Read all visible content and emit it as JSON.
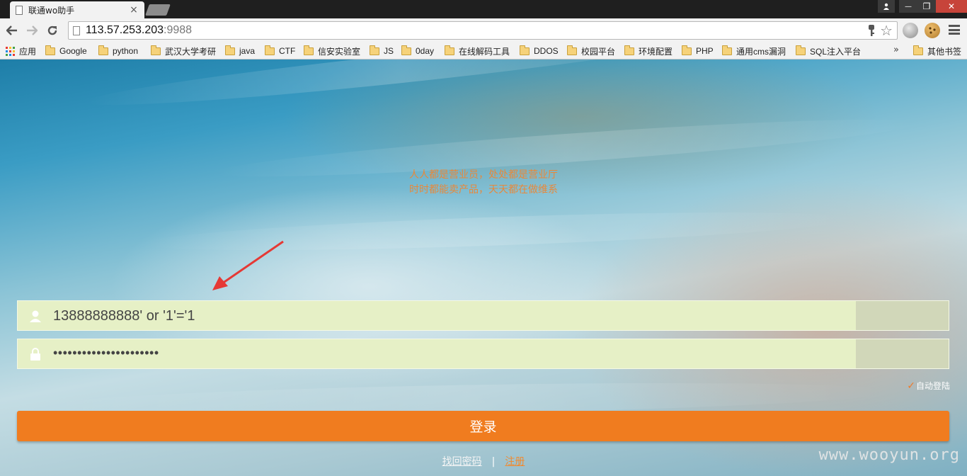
{
  "browser": {
    "tab_title": "联通wo助手",
    "tab_close": "×",
    "url_host": "113.57.253.203",
    "url_port": ":9988",
    "window_controls": [
      "user-icon",
      "minimize",
      "restore",
      "close"
    ],
    "window_control_glyphs": {
      "minimize": "—",
      "restore": "❐",
      "close": "✕"
    }
  },
  "bookmarks": {
    "apps_label": "应用",
    "items": [
      "Google",
      "python",
      "武汉大学考研",
      "java",
      "CTF",
      "信安实验室",
      "JS",
      "0day",
      "在线解码工具",
      "DDOS",
      "校园平台",
      "环境配置",
      "PHP",
      "通用cms漏洞",
      "SQL注入平台"
    ],
    "overflow": "»",
    "other_label": "其他书签"
  },
  "page": {
    "slogan_line1": "人人都是营业员，处处都是营业厅",
    "slogan_line2": "时时都能卖产品，天天都在做维系",
    "username_value": "13888888888' or '1'='1",
    "password_dots": "••••••••••••••••••••••",
    "auto_login_check": "✓",
    "auto_login_label": "自动登陆",
    "login_button": "登录",
    "forgot_password": "找回密码",
    "separator": "|",
    "register": "注册",
    "watermark": "www.wooyun.org"
  },
  "colors": {
    "accent": "#f07c1f",
    "slogan": "#e8883a",
    "input_bg": "#e6f0c6"
  }
}
